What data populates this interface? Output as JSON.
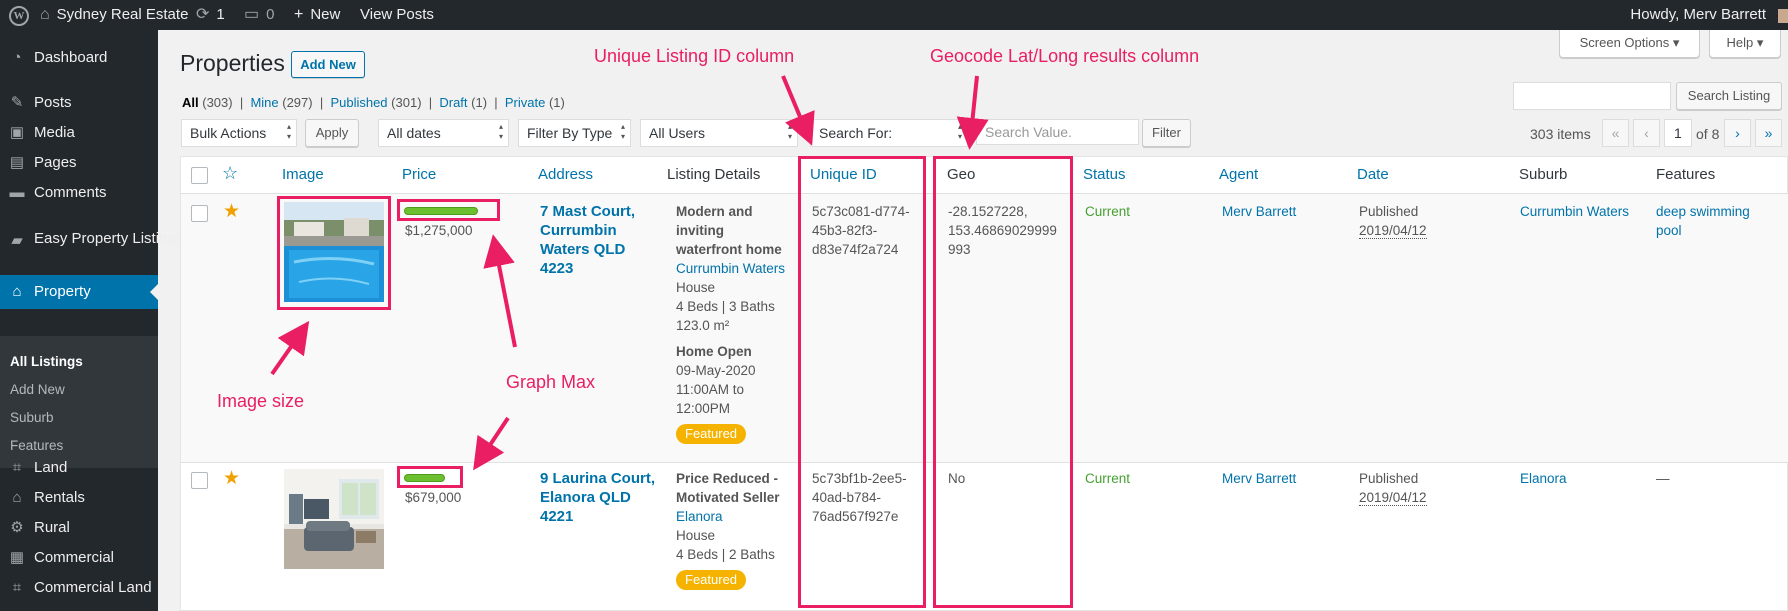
{
  "adminbar": {
    "site_name": "Sydney Real Estate",
    "updates_count": "1",
    "comments_count": "0",
    "new_label": "New",
    "view_posts": "View Posts",
    "howdy": "Howdy, Merv Barrett"
  },
  "sidebar": {
    "items": [
      {
        "label": "Dashboard",
        "icon": "dashboard-icon"
      },
      {
        "label": "Posts",
        "icon": "pin-icon"
      },
      {
        "label": "Media",
        "icon": "media-icon"
      },
      {
        "label": "Pages",
        "icon": "pages-icon"
      },
      {
        "label": "Comments",
        "icon": "comments-icon"
      },
      {
        "label": "Easy Property Listings",
        "icon": "folder-icon"
      },
      {
        "label": "Property",
        "icon": "home-icon"
      },
      {
        "label": "Land",
        "icon": "crop-icon"
      },
      {
        "label": "Rentals",
        "icon": "home-icon"
      },
      {
        "label": "Rural",
        "icon": "tractor-icon"
      },
      {
        "label": "Commercial",
        "icon": "building-icon"
      },
      {
        "label": "Commercial Land",
        "icon": "crop-icon"
      }
    ],
    "submenu": [
      "All Listings",
      "Add New",
      "Suburb",
      "Features"
    ]
  },
  "header": {
    "title": "Properties",
    "add_new": "Add New",
    "screen_options": "Screen Options",
    "help": "Help"
  },
  "subsub": {
    "all": "All",
    "all_count": "(303)",
    "mine": "Mine",
    "mine_count": "(297)",
    "published": "Published",
    "published_count": "(301)",
    "draft": "Draft",
    "draft_count": "(1)",
    "private": "Private",
    "private_count": "(1)"
  },
  "filters": {
    "bulk_actions": "Bulk Actions",
    "apply": "Apply",
    "all_dates": "All dates",
    "filter_by_type": "Filter By Type",
    "all_users": "All Users",
    "search_for": "Search For:",
    "search_value_placeholder": "Search Value.",
    "filter": "Filter",
    "search_listing": "Search Listing"
  },
  "pagination": {
    "items": "303 items",
    "first": "«",
    "prev": "‹",
    "current": "1",
    "of_pages": "of 8",
    "next": "›",
    "last": "»"
  },
  "columns": {
    "image": "Image",
    "price": "Price",
    "address": "Address",
    "listing_details": "Listing Details",
    "unique_id": "Unique ID",
    "geo": "Geo",
    "status": "Status",
    "agent": "Agent",
    "date": "Date",
    "suburb": "Suburb",
    "features": "Features"
  },
  "rows": [
    {
      "price": "$1,275,000",
      "price_bar_fraction": 0.9,
      "address_lines": [
        "7 Mast Court,",
        "Currumbin",
        "Waters QLD",
        "4223"
      ],
      "details_title_lines": [
        "Modern and",
        "inviting",
        "waterfront home"
      ],
      "suburb_link": "Currumbin Waters",
      "type": "House",
      "beds_baths": "4 Beds | 3 Baths",
      "area": "123.0 m²",
      "home_open_label": "Home Open",
      "home_open_lines": [
        "09-May-2020",
        "11:00AM to",
        "12:00PM"
      ],
      "badge": "Featured",
      "unique_id_lines": [
        "5c73c081-d774-",
        "45b3-82f3-",
        "d83e74f2a724"
      ],
      "geo_lines": [
        "-28.1527228,",
        "153.46869029999",
        "993"
      ],
      "status": "Current",
      "agent": "Merv Barrett",
      "date_label": "Published",
      "date": "2019/04/12",
      "suburb": "Currumbin Waters",
      "features_lines": [
        "deep swimming",
        "pool"
      ]
    },
    {
      "price": "$679,000",
      "price_bar_fraction": 0.5,
      "address_lines": [
        "9 Laurina Court,",
        "Elanora QLD",
        "4221"
      ],
      "details_title_lines": [
        "Price Reduced -",
        "Motivated Seller"
      ],
      "suburb_link": "Elanora",
      "type": "House",
      "beds_baths": "4 Beds | 2 Baths",
      "badge": "Featured",
      "unique_id_lines": [
        "5c73bf1b-2ee5-",
        "40ad-b784-",
        "76ad567f927e"
      ],
      "geo": "No",
      "status": "Current",
      "agent": "Merv Barrett",
      "date_label": "Published",
      "date": "2019/04/12",
      "suburb": "Elanora",
      "features": "—"
    }
  ],
  "annotations": {
    "unique_id_column": "Unique Listing ID column",
    "geocode_column": "Geocode Lat/Long results column",
    "image_size": "Image size",
    "graph_max": "Graph Max"
  },
  "colors": {
    "admin_bg": "#23282d",
    "accent": "#0073aa",
    "annotation": "#e91e63",
    "badge": "#f5b300",
    "status_green": "#46a030",
    "bar_green": "#6cbf2f"
  }
}
